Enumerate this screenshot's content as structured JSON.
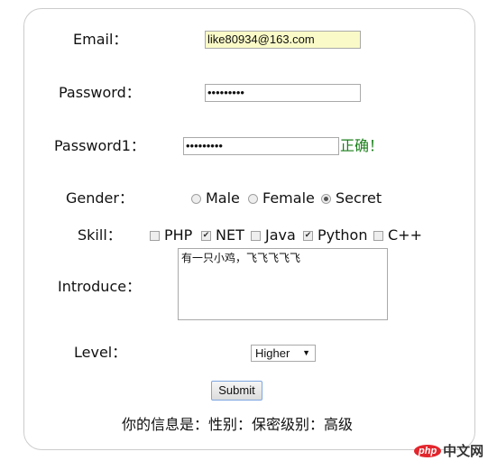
{
  "form": {
    "email": {
      "label": "Email：",
      "value": "like80934@163.com"
    },
    "password": {
      "label": "Password：",
      "value": "•••••••••"
    },
    "password1": {
      "label": "Password1：",
      "value": "•••••••••",
      "status": "正确！",
      "status_color": "#1a7f1a"
    },
    "gender": {
      "label": "Gender：",
      "options": [
        "Male",
        "Female",
        "Secret"
      ],
      "selected": "Secret"
    },
    "skill": {
      "label": "Skill：",
      "options": [
        {
          "label": "PHP",
          "checked": false
        },
        {
          "label": "NET",
          "checked": true
        },
        {
          "label": "Java",
          "checked": false
        },
        {
          "label": "Python",
          "checked": true
        },
        {
          "label": "C++",
          "checked": false
        }
      ]
    },
    "introduce": {
      "label": "Introduce：",
      "value": "有一只小鸡，飞飞飞飞飞"
    },
    "level": {
      "label": "Level：",
      "selected": "Higher"
    },
    "submit_label": "Submit",
    "result": "你的信息是：性别：保密级别：高级"
  },
  "watermark": {
    "logo": "php",
    "text": "中文网"
  },
  "colors": {
    "autofill_bg": "#fafac8",
    "border": "#cccccc"
  }
}
